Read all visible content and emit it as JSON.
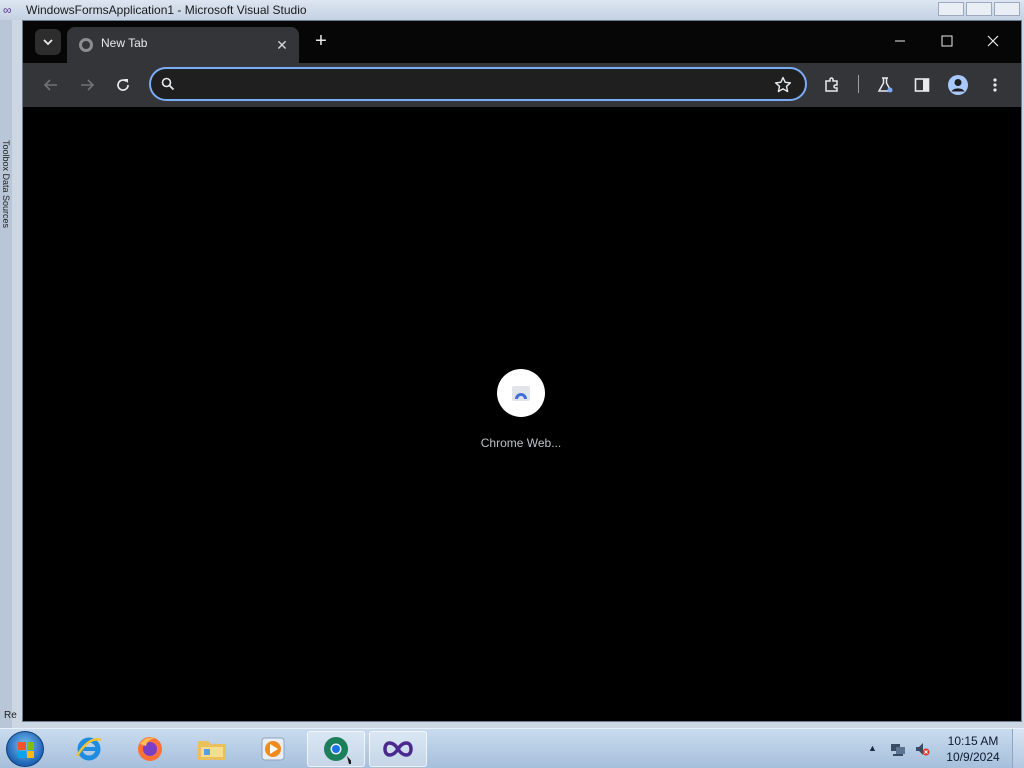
{
  "background_window": {
    "title": "WindowsFormsApplication1 - Microsoft Visual Studio",
    "side_tab_label": "Toolbox  Data Sources",
    "status_text": "Re"
  },
  "browser": {
    "tab": {
      "title": "New Tab",
      "close_symbol": "✕"
    },
    "new_tab_symbol": "+",
    "omnibox": {
      "value": "",
      "placeholder": ""
    },
    "loading_label": "Chrome Web...",
    "colors": {
      "frame": "#060606",
      "toolbar": "#333538",
      "accent": "#7cacf8"
    }
  },
  "taskbar": {
    "apps": [
      {
        "name": "internet-explorer"
      },
      {
        "name": "firefox"
      },
      {
        "name": "file-explorer"
      },
      {
        "name": "media-player"
      },
      {
        "name": "chrome",
        "active": true
      },
      {
        "name": "visual-studio"
      }
    ],
    "clock": {
      "time": "10:15 AM",
      "date": "10/9/2024"
    }
  }
}
